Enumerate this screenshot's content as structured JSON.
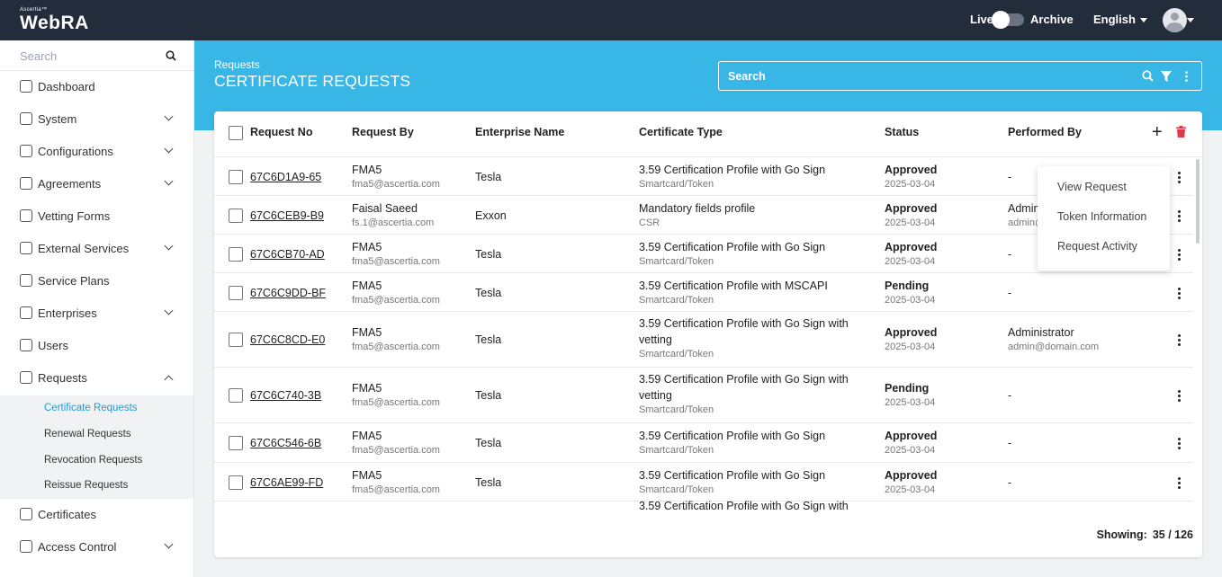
{
  "app": {
    "brand_small": "Ascertia™",
    "brand": "WebRA"
  },
  "topbar": {
    "live": "Live",
    "archive": "Archive",
    "language": "English"
  },
  "sidebar": {
    "search_placeholder": "Search",
    "items": [
      {
        "label": "Dashboard",
        "icon": "dashboard-icon",
        "chevron": false
      },
      {
        "label": "System",
        "icon": "system-icon",
        "chevron": true
      },
      {
        "label": "Configurations",
        "icon": "gear-icon",
        "chevron": true
      },
      {
        "label": "Agreements",
        "icon": "handshake-icon",
        "chevron": true
      },
      {
        "label": "Vetting Forms",
        "icon": "form-icon",
        "chevron": false
      },
      {
        "label": "External Services",
        "icon": "link-icon",
        "chevron": true
      },
      {
        "label": "Service Plans",
        "icon": "plans-icon",
        "chevron": false
      },
      {
        "label": "Enterprises",
        "icon": "bank-icon",
        "chevron": true
      },
      {
        "label": "Users",
        "icon": "user-icon",
        "chevron": false
      },
      {
        "label": "Requests",
        "icon": "requests-icon",
        "chevron": true
      },
      {
        "label": "Certificates",
        "icon": "certificate-icon",
        "chevron": false
      },
      {
        "label": "Access Control",
        "icon": "lock-icon",
        "chevron": true
      }
    ],
    "sub_items": [
      "Certificate Requests",
      "Renewal Requests",
      "Revocation Requests",
      "Reissue Requests"
    ]
  },
  "header": {
    "breadcrumb": "Requests",
    "title": "CERTIFICATE REQUESTS",
    "search_placeholder": "Search"
  },
  "table": {
    "columns": [
      "Request No",
      "Request By",
      "Enterprise Name",
      "Certificate Type",
      "Status",
      "Performed By"
    ],
    "rows": [
      {
        "id": "67C6D1A9-65",
        "by": "FMA5",
        "email": "fma5@ascertia.com",
        "enterprise": "Tesla",
        "cert": "3.59 Certification Profile with Go Sign",
        "cert_sub": "Smartcard/Token",
        "status": "Approved",
        "date": "2025-03-04",
        "perf": "-",
        "perf_sub": ""
      },
      {
        "id": "67C6CEB9-B9",
        "by": "Faisal Saeed",
        "email": "fs.1@ascertia.com",
        "enterprise": "Exxon",
        "cert": "Mandatory fields profile",
        "cert_sub": "CSR",
        "status": "Approved",
        "date": "2025-03-04",
        "perf": "Admin",
        "perf_sub": "admin@"
      },
      {
        "id": "67C6CB70-AD",
        "by": "FMA5",
        "email": "fma5@ascertia.com",
        "enterprise": "Tesla",
        "cert": "3.59 Certification Profile with Go Sign",
        "cert_sub": "Smartcard/Token",
        "status": "Approved",
        "date": "2025-03-04",
        "perf": "-",
        "perf_sub": ""
      },
      {
        "id": "67C6C9DD-BF",
        "by": "FMA5",
        "email": "fma5@ascertia.com",
        "enterprise": "Tesla",
        "cert": "3.59 Certification Profile with MSCAPI",
        "cert_sub": "Smartcard/Token",
        "status": "Pending",
        "date": "2025-03-04",
        "perf": "-",
        "perf_sub": ""
      },
      {
        "id": "67C6C8CD-E0",
        "by": "FMA5",
        "email": "fma5@ascertia.com",
        "enterprise": "Tesla",
        "cert": "3.59 Certification Profile with Go Sign with vetting",
        "cert_sub": "Smartcard/Token",
        "status": "Approved",
        "date": "2025-03-04",
        "perf": "Administrator",
        "perf_sub": "admin@domain.com"
      },
      {
        "id": "67C6C740-3B",
        "by": "FMA5",
        "email": "fma5@ascertia.com",
        "enterprise": "Tesla",
        "cert": "3.59 Certification Profile with Go Sign with vetting",
        "cert_sub": "Smartcard/Token",
        "status": "Pending",
        "date": "2025-03-04",
        "perf": "-",
        "perf_sub": ""
      },
      {
        "id": "67C6C546-6B",
        "by": "FMA5",
        "email": "fma5@ascertia.com",
        "enterprise": "Tesla",
        "cert": "3.59 Certification Profile with Go Sign",
        "cert_sub": "Smartcard/Token",
        "status": "Approved",
        "date": "2025-03-04",
        "perf": "-",
        "perf_sub": ""
      },
      {
        "id": "67C6AE99-FD",
        "by": "FMA5",
        "email": "fma5@ascertia.com",
        "enterprise": "Tesla",
        "cert": "3.59 Certification Profile with Go Sign",
        "cert_sub": "Smartcard/Token",
        "status": "Approved",
        "date": "2025-03-04",
        "perf": "-",
        "perf_sub": ""
      },
      {
        "id": "",
        "by": "",
        "email": "",
        "enterprise": "",
        "cert": "3.59 Certification Profile with Go Sign with",
        "cert_sub": "",
        "status": "",
        "date": "",
        "perf": "",
        "perf_sub": ""
      }
    ]
  },
  "footer": {
    "showing_label": "Showing:",
    "showing_value": "35 / 126"
  },
  "context_menu": {
    "items": [
      "View Request",
      "Token Information",
      "Request Activity"
    ]
  },
  "colors": {
    "topbar": "#232c3b",
    "accent": "#38b6e6",
    "active_link": "#1e9bd7",
    "delete": "#e03a4a"
  }
}
